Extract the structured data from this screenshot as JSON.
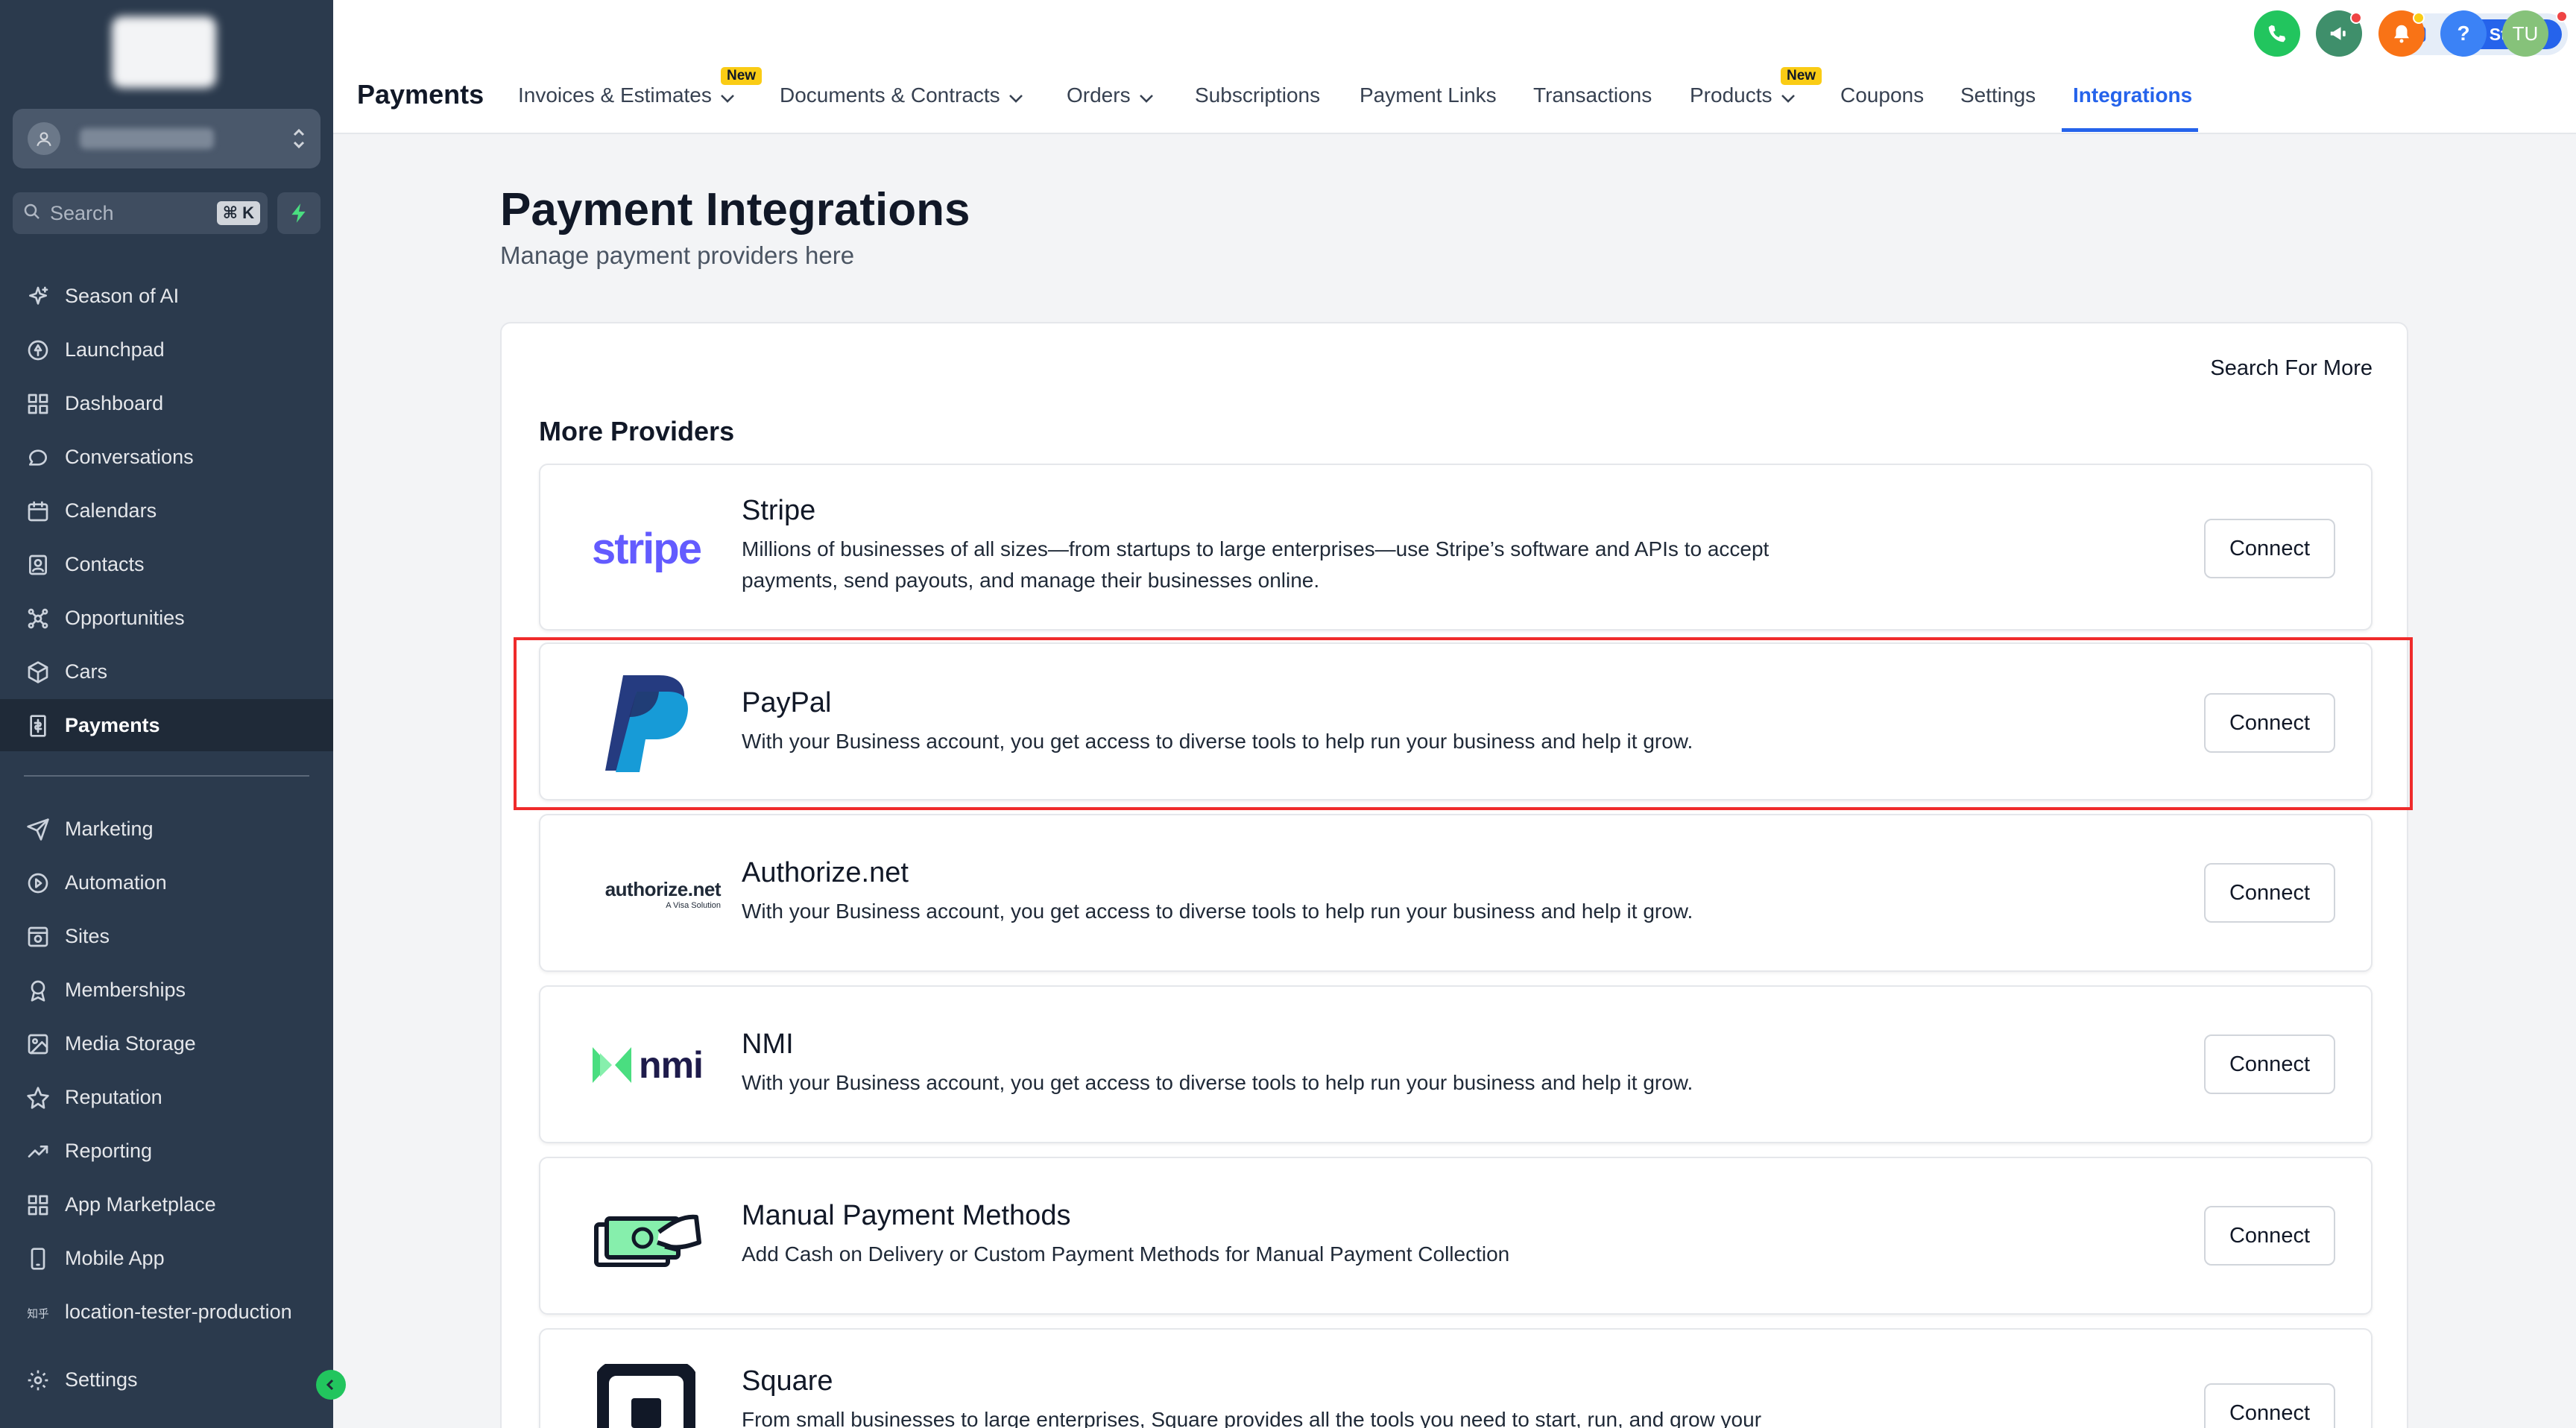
{
  "sidebar": {
    "search": {
      "label": "Search",
      "shortcut": "⌘ K"
    },
    "items_top": [
      {
        "label": "Season of AI",
        "icon": "sparkle-icon"
      },
      {
        "label": "Launchpad",
        "icon": "rocket-icon"
      },
      {
        "label": "Dashboard",
        "icon": "grid-icon"
      },
      {
        "label": "Conversations",
        "icon": "chat-icon"
      },
      {
        "label": "Calendars",
        "icon": "calendar-icon"
      },
      {
        "label": "Contacts",
        "icon": "contacts-icon"
      },
      {
        "label": "Opportunities",
        "icon": "network-icon"
      },
      {
        "label": "Cars",
        "icon": "box-icon"
      },
      {
        "label": "Payments",
        "icon": "invoice-icon",
        "active": true
      }
    ],
    "items_bottom": [
      {
        "label": "Marketing",
        "icon": "send-icon"
      },
      {
        "label": "Automation",
        "icon": "automation-icon"
      },
      {
        "label": "Sites",
        "icon": "sites-icon"
      },
      {
        "label": "Memberships",
        "icon": "award-icon"
      },
      {
        "label": "Media Storage",
        "icon": "image-icon"
      },
      {
        "label": "Reputation",
        "icon": "star-icon"
      },
      {
        "label": "Reporting",
        "icon": "trend-icon"
      },
      {
        "label": "App Marketplace",
        "icon": "apps-icon"
      },
      {
        "label": "Mobile App",
        "icon": "phone-icon"
      },
      {
        "label": "location-tester-production",
        "icon": "location-icon"
      }
    ],
    "settings": {
      "label": "Settings",
      "icon": "gear-icon"
    }
  },
  "header": {
    "title": "Payments",
    "tabs": [
      {
        "label": "Invoices & Estimates",
        "dropdown": true,
        "badge": "New"
      },
      {
        "label": "Documents & Contracts",
        "dropdown": true
      },
      {
        "label": "Orders",
        "dropdown": true
      },
      {
        "label": "Subscriptions"
      },
      {
        "label": "Payment Links"
      },
      {
        "label": "Transactions"
      },
      {
        "label": "Products",
        "dropdown": true,
        "badge": "New"
      },
      {
        "label": "Coupons"
      },
      {
        "label": "Settings"
      },
      {
        "label": "Integrations",
        "active": true
      }
    ],
    "get_started": "Get Started",
    "help": "?",
    "avatar_initials": "TU"
  },
  "main": {
    "title": "Payment Integrations",
    "subtitle": "Manage payment providers here",
    "search_more": "Search For More",
    "section_title": "More Providers",
    "providers": [
      {
        "name": "Stripe",
        "logo_text": "stripe",
        "description": "Millions of businesses of all sizes—from startups to large enterprises—use Stripe’s software and APIs to accept payments, send payouts, and manage their businesses online.",
        "action": "Connect"
      },
      {
        "name": "PayPal",
        "logo_text": "",
        "description": "With your Business account, you get access to diverse tools to help run your business and help it grow.",
        "action": "Connect"
      },
      {
        "name": "Authorize.net",
        "logo_text": "authorize.net",
        "logo_subtext": "A Visa Solution",
        "description": "With your Business account, you get access to diverse tools to help run your business and help it grow.",
        "action": "Connect"
      },
      {
        "name": "NMI",
        "logo_text": "nmi",
        "description": "With your Business account, you get access to diverse tools to help run your business and help it grow.",
        "action": "Connect"
      },
      {
        "name": "Manual Payment Methods",
        "logo_text": "",
        "description": "Add Cash on Delivery or Custom Payment Methods for Manual Payment Collection",
        "action": "Connect"
      },
      {
        "name": "Square",
        "logo_text": "",
        "description": "From small businesses to large enterprises, Square provides all the tools you need to start, run, and grow your",
        "action": "Connect"
      }
    ]
  },
  "colors": {
    "sidebar_bg": "#2b3a4d",
    "accent": "#2563eb",
    "highlight": "#ef2b2b",
    "stripe": "#635bff",
    "paypal_dark": "#253b80",
    "paypal_light": "#179bd7",
    "nmi_green": "#4ade80"
  }
}
